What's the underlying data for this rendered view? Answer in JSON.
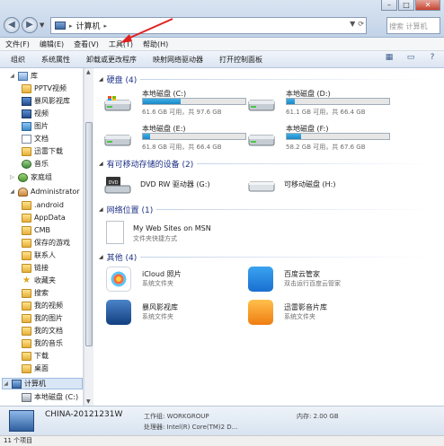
{
  "window": {
    "breadcrumb_root": "计算机",
    "search_placeholder": "搜索 计算机"
  },
  "menu": [
    "文件(F)",
    "编辑(E)",
    "查看(V)",
    "工具(T)",
    "帮助(H)"
  ],
  "toolbar": [
    "组织",
    "系统属性",
    "卸载或更改程序",
    "映射网络驱动器",
    "打开控制面板"
  ],
  "sidebar": {
    "items": [
      {
        "label": "库",
        "icon": "library-icon"
      },
      {
        "label": "PPTV视频",
        "icon": "folder-icon"
      },
      {
        "label": "暴风影视库",
        "icon": "video-icon"
      },
      {
        "label": "视频",
        "icon": "video-icon"
      },
      {
        "label": "图片",
        "icon": "image-icon"
      },
      {
        "label": "文档",
        "icon": "document-icon"
      },
      {
        "label": "迅雷下载",
        "icon": "folder-icon"
      },
      {
        "label": "音乐",
        "icon": "music-icon"
      },
      {
        "label": "家庭组",
        "icon": "homegroup-icon"
      },
      {
        "label": "Administrator",
        "icon": "user-icon"
      },
      {
        "label": ".android",
        "icon": "folder-icon"
      },
      {
        "label": "AppData",
        "icon": "folder-icon"
      },
      {
        "label": "CMB",
        "icon": "folder-icon"
      },
      {
        "label": "保存的游戏",
        "icon": "folder-icon"
      },
      {
        "label": "联系人",
        "icon": "folder-icon"
      },
      {
        "label": "链接",
        "icon": "folder-icon"
      },
      {
        "label": "收藏夹",
        "icon": "star-icon"
      },
      {
        "label": "搜索",
        "icon": "folder-icon"
      },
      {
        "label": "我的视频",
        "icon": "folder-icon"
      },
      {
        "label": "我的图片",
        "icon": "folder-icon"
      },
      {
        "label": "我的文档",
        "icon": "folder-icon"
      },
      {
        "label": "我的音乐",
        "icon": "folder-icon"
      },
      {
        "label": "下载",
        "icon": "folder-icon"
      },
      {
        "label": "桌面",
        "icon": "folder-icon"
      },
      {
        "label": "计算机",
        "icon": "computer-icon"
      },
      {
        "label": "本地磁盘 (C:)",
        "icon": "drive-icon"
      }
    ]
  },
  "groups": {
    "hard_disks": "硬盘 (4)",
    "removable": "有可移动存储的设备 (2)",
    "network": "网络位置 (1)",
    "other": "其他 (4)"
  },
  "drives": [
    {
      "name": "本地磁盘 (C:)",
      "size": "61.6 GB 可用，共 97.6 GB",
      "used_fraction": 0.37
    },
    {
      "name": "本地磁盘 (D:)",
      "size": "61.1 GB 可用，共 66.4 GB",
      "used_fraction": 0.08
    },
    {
      "name": "本地磁盘 (E:)",
      "size": "61.8 GB 可用，共 66.4 GB",
      "used_fraction": 0.07
    },
    {
      "name": "本地磁盘 (F:)",
      "size": "58.2 GB 可用，共 67.6 GB",
      "used_fraction": 0.14
    }
  ],
  "devices": [
    {
      "name": "DVD RW 驱动器 (G:)"
    },
    {
      "name": "可移动磁盘 (H:)"
    }
  ],
  "network_location": {
    "name": "My Web Sites on MSN",
    "sub": "文件夹快捷方式"
  },
  "others": [
    {
      "name": "iCloud 照片",
      "sub": "系统文件夹"
    },
    {
      "name": "百度云管家",
      "sub": "双击运行百度云管家"
    },
    {
      "name": "暴风影视库",
      "sub": "系统文件夹"
    },
    {
      "name": "迅雷影音片库",
      "sub": "系统文件夹"
    }
  ],
  "details": {
    "computer_name": "CHINA-20121231W",
    "workgroup": "工作组: WORKGROUP",
    "memory": "内存: 2.00 GB",
    "processor": "处理器: Intel(R) Core(TM)2 D..."
  },
  "status": "11 个项目",
  "colors": {
    "accent": "#1e3287",
    "drive_fill": "#1886c6",
    "annotation_arrow": "#e02020"
  }
}
